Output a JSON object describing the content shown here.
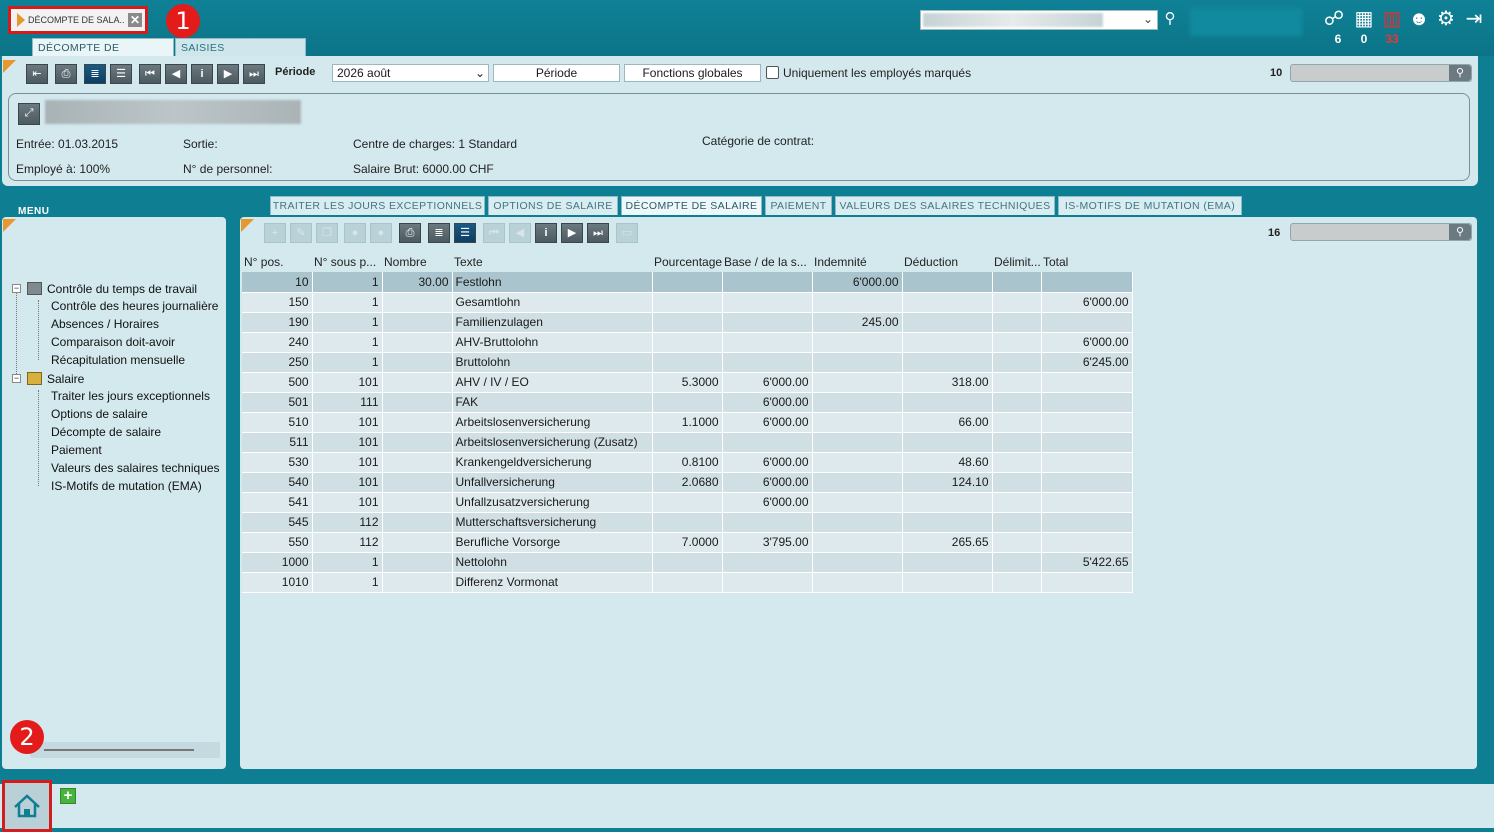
{
  "top": {
    "doc_tab_label": "DÉCOMPTE DE SALA...",
    "callout_1": "1",
    "callout_2": "2",
    "subtabs": [
      "DÉCOMPTE DE SALAIRE",
      "SAISIES MENSUELLES"
    ],
    "badges": [
      "6",
      "0",
      "33"
    ]
  },
  "toolbar": {
    "periode_label": "Période",
    "periode_value": "2026 août",
    "periode_button": "Période",
    "fonctions_button": "Fonctions globales",
    "uniquement_label": "Uniquement les employés marqués",
    "record_count": "10"
  },
  "employee": {
    "entree": "Entrée: 01.03.2015",
    "sortie": "Sortie:",
    "centre": "Centre de charges: 1 Standard",
    "categorie": "Catégorie de contrat:",
    "employe": "Employé à: 100%",
    "personnel": "N° de personnel:",
    "salaire": "Salaire Brut: 6000.00 CHF"
  },
  "menu": {
    "title": "MENU",
    "groups": [
      {
        "label": "Contrôle du temps de travail",
        "items": [
          "Contrôle des heures journalière",
          "Absences / Horaires",
          "Comparaison doit-avoir",
          "Récapitulation mensuelle"
        ]
      },
      {
        "label": "Salaire",
        "items": [
          "Traiter les jours exceptionnels",
          "Options de salaire",
          "Décompte de salaire",
          "Paiement",
          "Valeurs des salaires techniques",
          "IS-Motifs de mutation (EMA)"
        ]
      }
    ]
  },
  "content": {
    "tabs": [
      "TRAITER LES JOURS EXCEPTIONNELS",
      "OPTIONS DE SALAIRE",
      "DÉCOMPTE DE SALAIRE",
      "PAIEMENT",
      "VALEURS DES SALAIRES TECHNIQUES",
      "IS-MOTIFS DE MUTATION (EMA)"
    ],
    "record_count": "16",
    "columns": [
      "N° pos.",
      "N° sous p...",
      "Nombre",
      "Texte",
      "Pourcentage",
      "Base / de la s...",
      "Indemnité",
      "Déduction",
      "Délimit...",
      "Total"
    ],
    "rows": [
      [
        "10",
        "1",
        "30.00",
        "Festlohn",
        "",
        "",
        "6'000.00",
        "",
        "",
        ""
      ],
      [
        "150",
        "1",
        "",
        "Gesamtlohn",
        "",
        "",
        "",
        "",
        "",
        "6'000.00"
      ],
      [
        "190",
        "1",
        "",
        "Familienzulagen",
        "",
        "",
        "245.00",
        "",
        "",
        ""
      ],
      [
        "240",
        "1",
        "",
        "AHV-Bruttolohn",
        "",
        "",
        "",
        "",
        "",
        "6'000.00"
      ],
      [
        "250",
        "1",
        "",
        "Bruttolohn",
        "",
        "",
        "",
        "",
        "",
        "6'245.00"
      ],
      [
        "500",
        "101",
        "",
        "AHV / IV / EO",
        "5.3000",
        "6'000.00",
        "",
        "318.00",
        "",
        ""
      ],
      [
        "501",
        "111",
        "",
        "FAK",
        "",
        "6'000.00",
        "",
        "",
        "",
        ""
      ],
      [
        "510",
        "101",
        "",
        "Arbeitslosenversicherung",
        "1.1000",
        "6'000.00",
        "",
        "66.00",
        "",
        ""
      ],
      [
        "511",
        "101",
        "",
        "Arbeitslosenversicherung (Zusatz)",
        "",
        "",
        "",
        "",
        "",
        ""
      ],
      [
        "530",
        "101",
        "",
        "Krankengeldversicherung",
        "0.8100",
        "6'000.00",
        "",
        "48.60",
        "",
        ""
      ],
      [
        "540",
        "101",
        "",
        "Unfallversicherung",
        "2.0680",
        "6'000.00",
        "",
        "124.10",
        "",
        ""
      ],
      [
        "541",
        "101",
        "",
        "Unfallzusatzversicherung",
        "",
        "6'000.00",
        "",
        "",
        "",
        ""
      ],
      [
        "545",
        "112",
        "",
        "Mutterschaftsversicherung",
        "",
        "",
        "",
        "",
        "",
        ""
      ],
      [
        "550",
        "112",
        "",
        "Berufliche Vorsorge",
        "7.0000",
        "3'795.00",
        "",
        "265.65",
        "",
        ""
      ],
      [
        "1000",
        "1",
        "",
        "Nettolohn",
        "",
        "",
        "",
        "",
        "",
        "5'422.65"
      ],
      [
        "1010",
        "1",
        "",
        "Differenz Vormonat",
        "",
        "",
        "",
        "",
        "",
        ""
      ]
    ]
  }
}
